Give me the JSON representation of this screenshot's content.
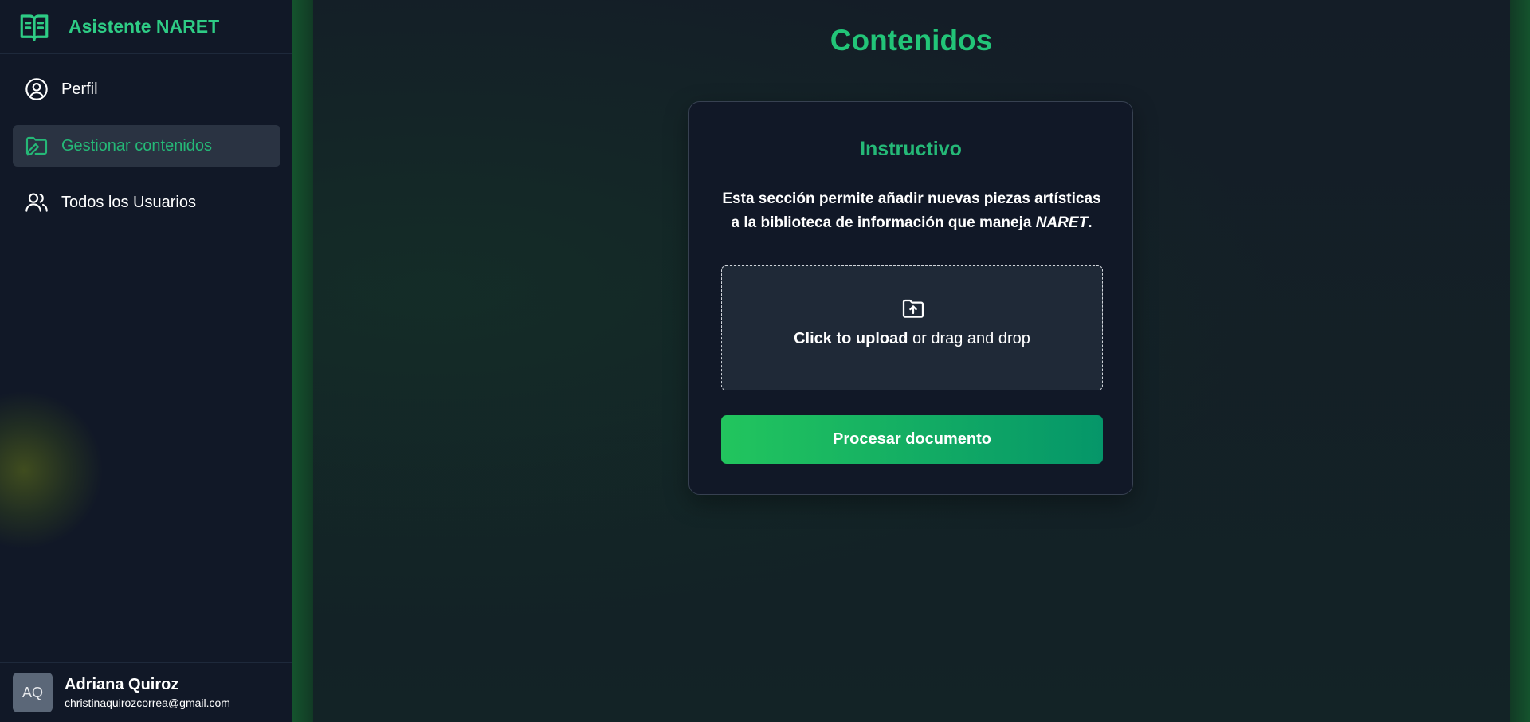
{
  "app": {
    "title": "Asistente NARET",
    "brand_icon": "open-book-icon",
    "accent_color": "#22c578"
  },
  "sidebar": {
    "items": [
      {
        "label": "Perfil",
        "icon": "user-circle-icon",
        "active": false
      },
      {
        "label": "Gestionar contenidos",
        "icon": "folder-edit-icon",
        "active": true
      },
      {
        "label": "Todos los Usuarios",
        "icon": "users-icon",
        "active": false
      }
    ]
  },
  "user": {
    "initials": "AQ",
    "name": "Adriana Quiroz",
    "email": "christinaquirozcorrea@gmail.com"
  },
  "main": {
    "title": "Contenidos",
    "card": {
      "title": "Instructivo",
      "description_line1": "Esta sección permite añadir nuevas piezas artísticas",
      "description_line2_prefix": "a la biblioteca de información que maneja ",
      "description_line2_emphasis": "NARET",
      "description_line2_suffix": ".",
      "upload": {
        "icon": "folder-upload-icon",
        "bold_text": "Click to upload",
        "rest_text": " or drag and drop"
      },
      "button_label": "Procesar documento"
    }
  }
}
